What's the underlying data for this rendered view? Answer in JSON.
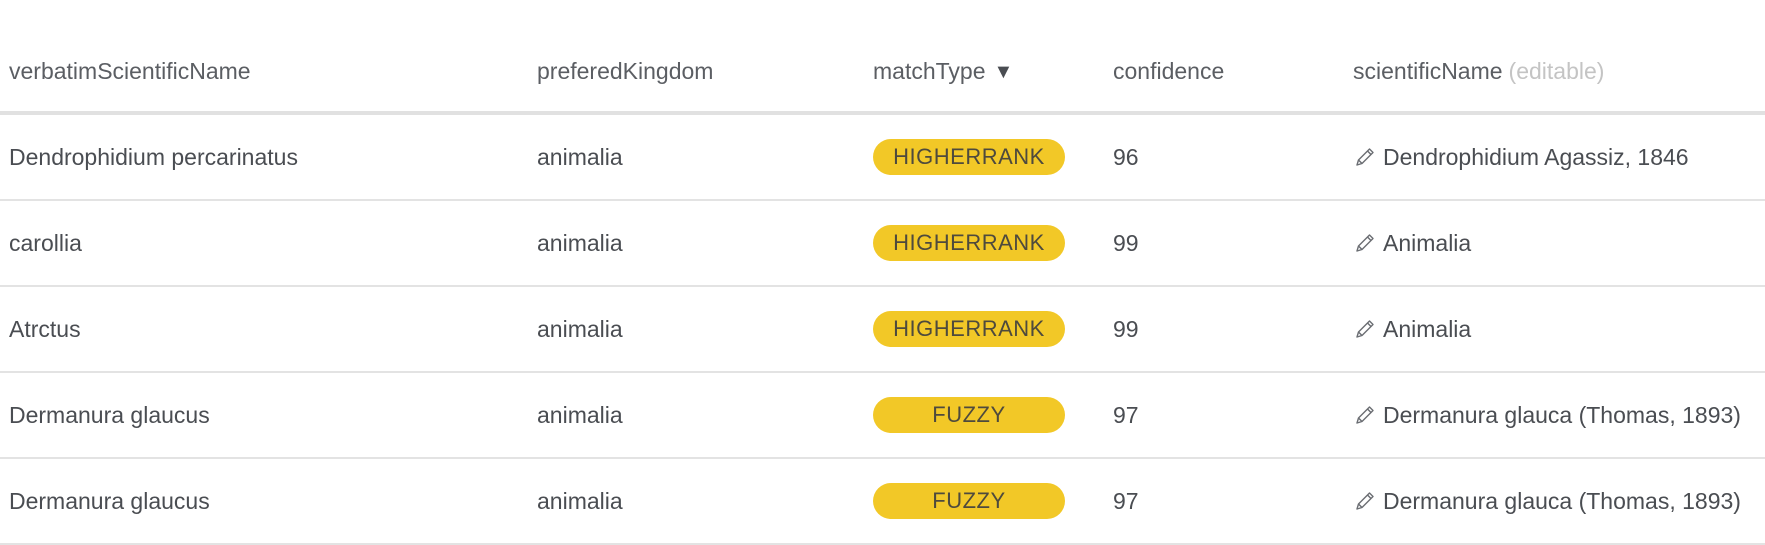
{
  "columns": {
    "verbatim": "verbatimScientificName",
    "kingdom": "preferedKingdom",
    "matchType": "matchType",
    "matchTypeSortIcon": "▼",
    "confidence": "confidence",
    "scientificName": "scientificName",
    "scientificNameHint": "(editable)"
  },
  "icons": {
    "sort": "sort-descending-icon",
    "edit": "pencil-icon"
  },
  "colors": {
    "badge": "#f2c827",
    "text": "#4a4d52",
    "muted": "#c4c4c4",
    "divider": "#e3e3e3"
  },
  "rows": [
    {
      "verbatim": "Dendrophidium percarinatus",
      "kingdom": "animalia",
      "matchType": "HIGHERRANK",
      "confidence": "96",
      "scientificName": "Dendrophidium Agassiz, 1846"
    },
    {
      "verbatim": "carollia",
      "kingdom": "animalia",
      "matchType": "HIGHERRANK",
      "confidence": "99",
      "scientificName": "Animalia"
    },
    {
      "verbatim": "Atrctus",
      "kingdom": "animalia",
      "matchType": "HIGHERRANK",
      "confidence": "99",
      "scientificName": "Animalia"
    },
    {
      "verbatim": "Dermanura glaucus",
      "kingdom": "animalia",
      "matchType": "FUZZY",
      "confidence": "97",
      "scientificName": "Dermanura glauca (Thomas, 1893)"
    },
    {
      "verbatim": "Dermanura glaucus",
      "kingdom": "animalia",
      "matchType": "FUZZY",
      "confidence": "97",
      "scientificName": "Dermanura glauca (Thomas, 1893)"
    }
  ]
}
